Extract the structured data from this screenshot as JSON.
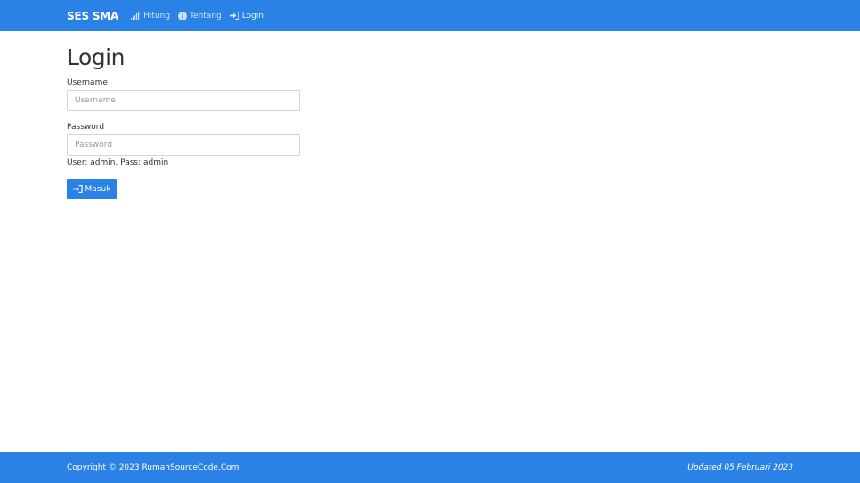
{
  "navbar": {
    "brand": "SES SMA",
    "links": [
      {
        "label": "Hitung",
        "icon": "signal-bars-icon"
      },
      {
        "label": "Tentang",
        "icon": "info-circle-icon"
      },
      {
        "label": "Login",
        "icon": "sign-in-icon"
      }
    ]
  },
  "login": {
    "title": "Login",
    "username_label": "Username",
    "username_placeholder": "Username",
    "username_value": "",
    "password_label": "Password",
    "password_placeholder": "Password",
    "password_value": "",
    "hint": "User: admin, Pass: admin",
    "submit_label": "Masuk",
    "submit_icon": "sign-in-icon"
  },
  "footer": {
    "copyright": "Copyright © 2023 RumahSourceCode.Com",
    "updated": "Updated 05 Februari 2023"
  },
  "colors": {
    "primary": "#2b82e6",
    "navbar_text": "#ffffff",
    "nav_link_text": "#cfe3fb"
  }
}
